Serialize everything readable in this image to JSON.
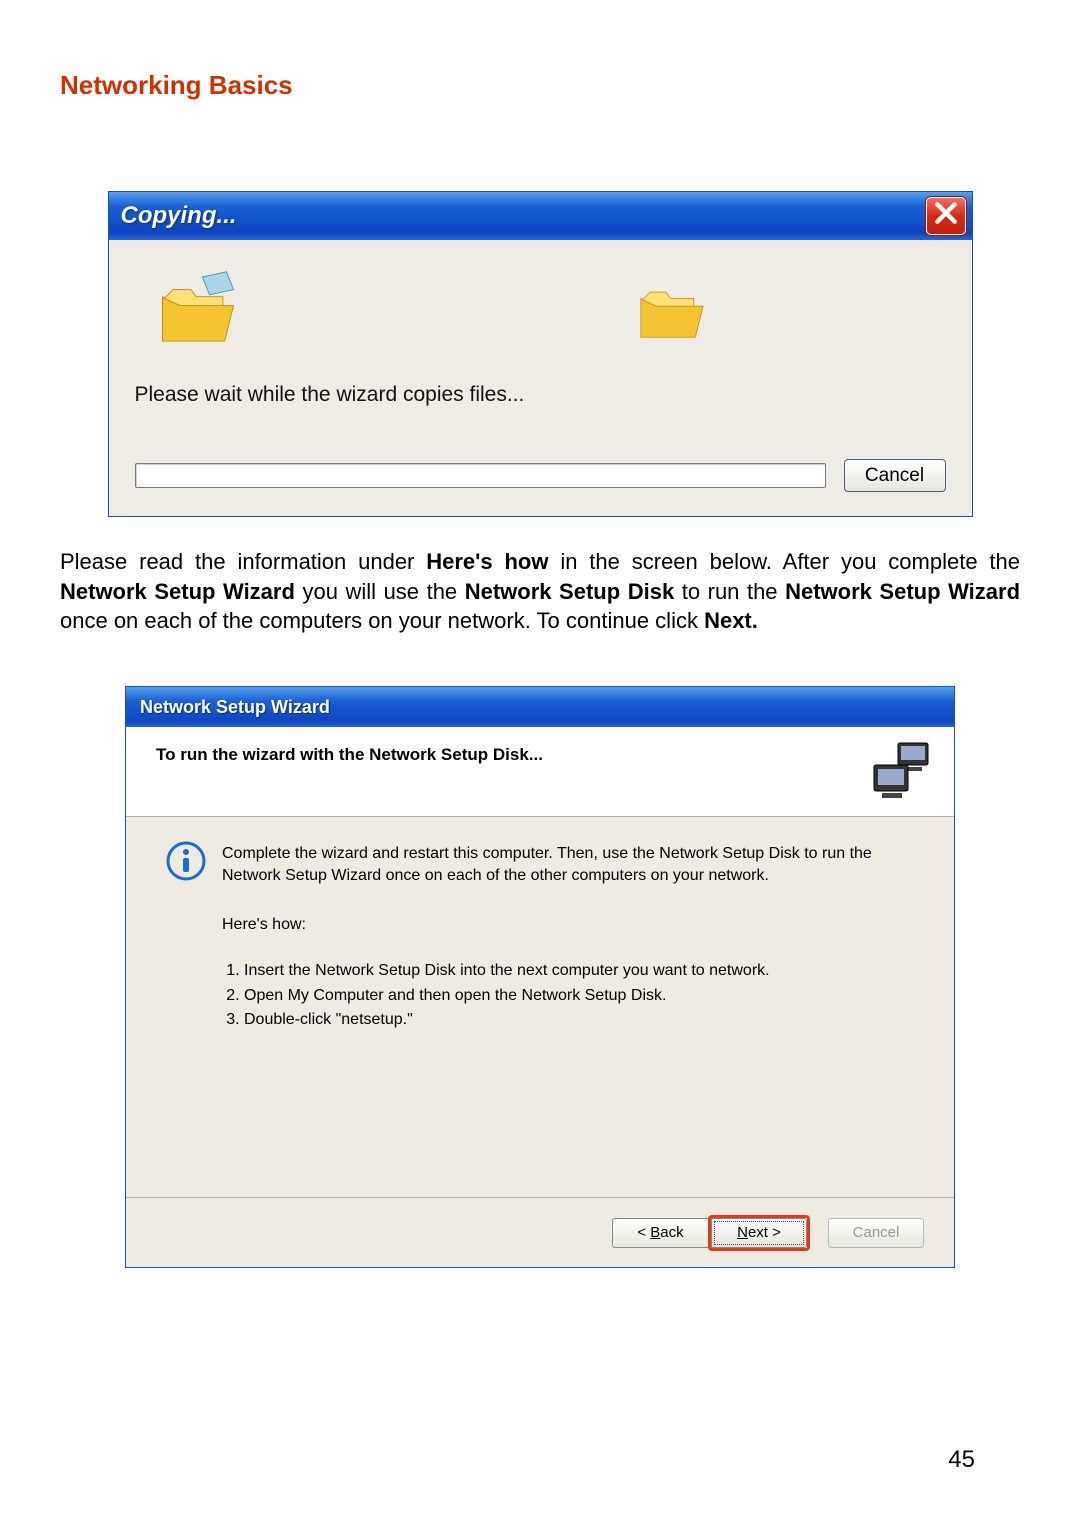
{
  "section_title": "Networking Basics",
  "page_number": "45",
  "copy_dialog": {
    "title": "Copying...",
    "wait_text": "Please wait while the wizard copies files...",
    "cancel_label": "Cancel"
  },
  "body_paragraph": {
    "t1": "Please read the information under ",
    "b1": "Here's how",
    "t2": " in the screen below.  After you complete the ",
    "b2": "Network Setup Wizard",
    "t3": " you will use the ",
    "b3": "Network Setup Disk",
    "t4": " to run the ",
    "b4": "Network Setup Wizard",
    "t5": " once on each of the computers on your network. To continue click ",
    "b5": "Next.",
    "t6": ""
  },
  "wizard_dialog": {
    "title": "Network Setup Wizard",
    "header_text": "To run the wizard with the Network Setup Disk...",
    "info_text": "Complete the wizard and restart this computer. Then, use the Network Setup Disk to run the Network Setup Wizard once on each of the other computers on your network.",
    "hereshow_label": "Here's how:",
    "steps": [
      "Insert the Network Setup Disk into the next computer you want to network.",
      "Open My Computer and then open the Network Setup Disk.",
      "Double-click \"netsetup.\""
    ],
    "back_label": "< Back",
    "next_label": "Next >",
    "cancel_label": "Cancel"
  }
}
